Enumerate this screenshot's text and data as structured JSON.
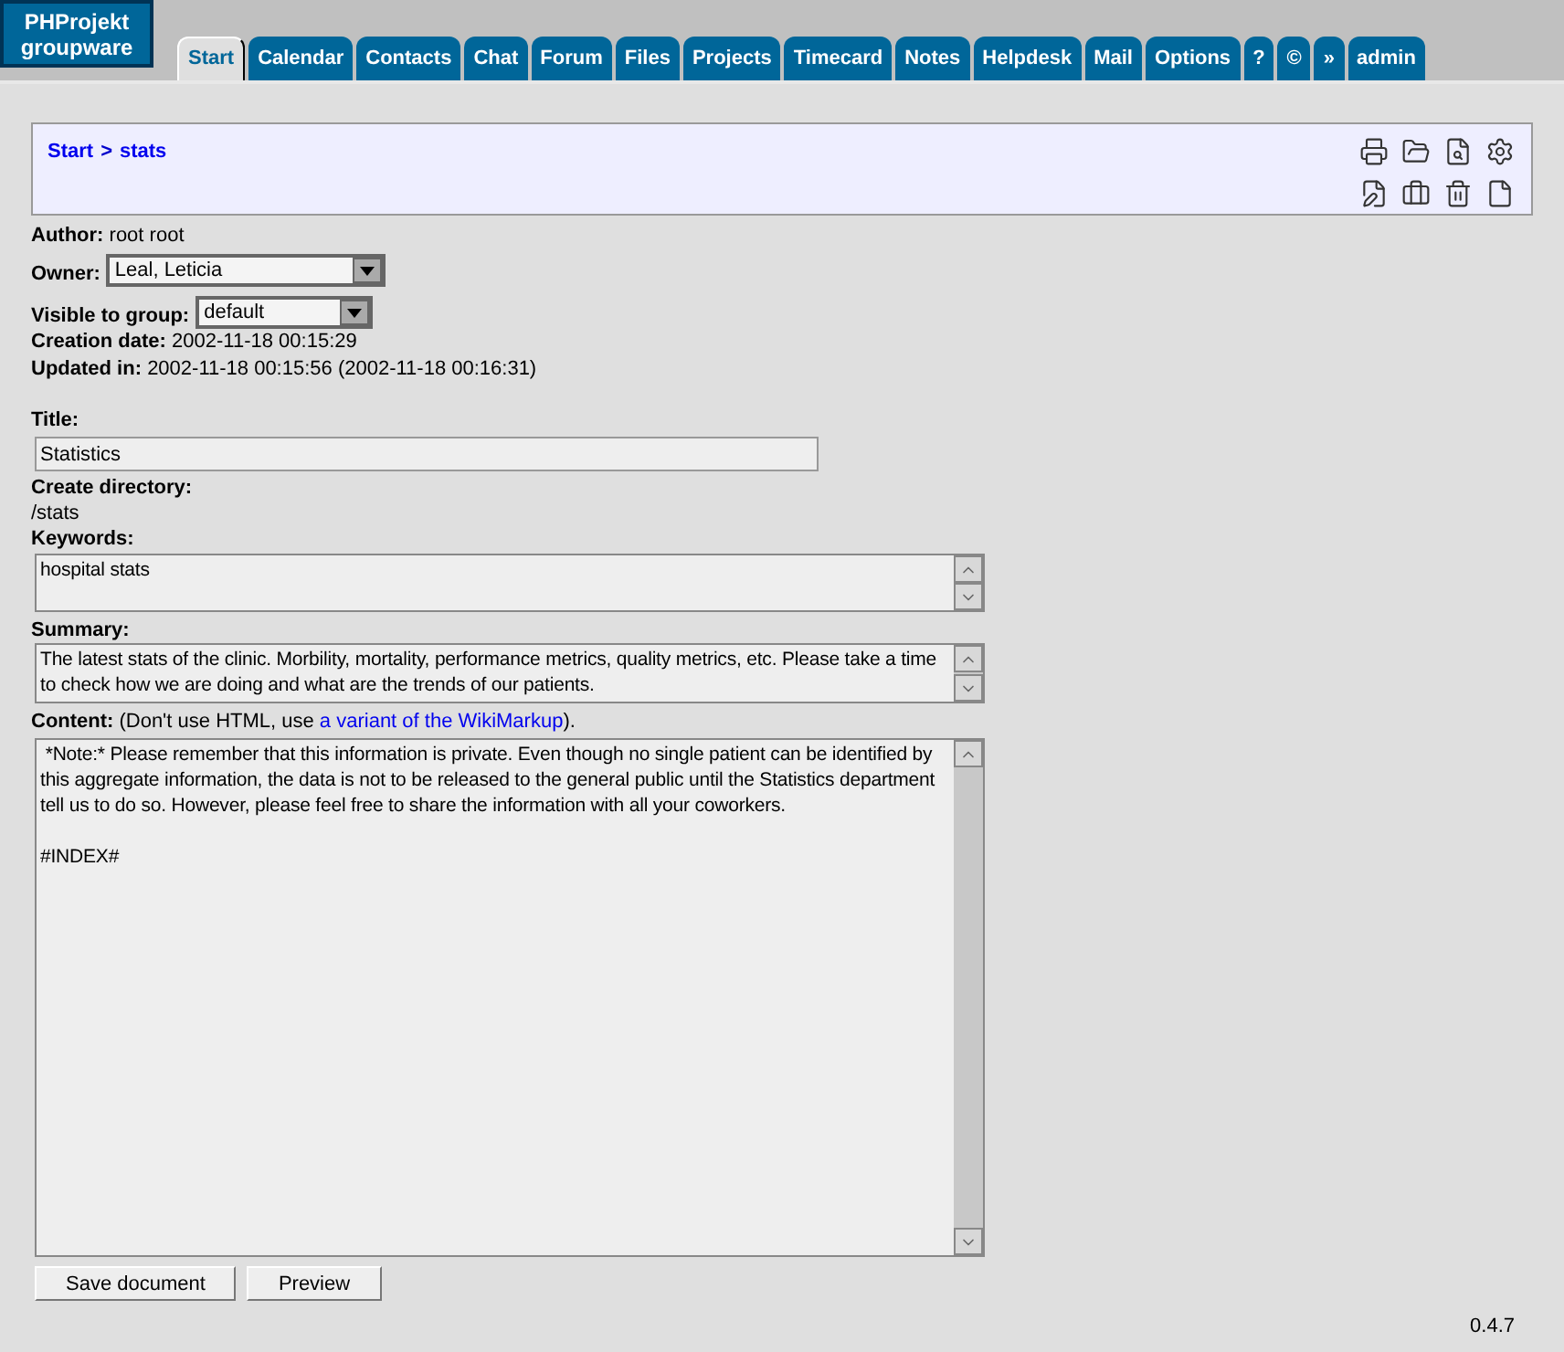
{
  "logo": {
    "line1": "PHProjekt",
    "line2": "groupware"
  },
  "tabs": [
    {
      "label": "Start",
      "selected": true
    },
    {
      "label": "Calendar",
      "selected": false
    },
    {
      "label": "Contacts",
      "selected": false
    },
    {
      "label": "Chat",
      "selected": false
    },
    {
      "label": "Forum",
      "selected": false
    },
    {
      "label": "Files",
      "selected": false
    },
    {
      "label": "Projects",
      "selected": false
    },
    {
      "label": "Timecard",
      "selected": false
    },
    {
      "label": "Notes",
      "selected": false
    },
    {
      "label": "Helpdesk",
      "selected": false
    },
    {
      "label": "Mail",
      "selected": false
    },
    {
      "label": "Options",
      "selected": false
    },
    {
      "label": "?",
      "selected": false
    },
    {
      "label": "©",
      "selected": false
    },
    {
      "label": "»",
      "selected": false
    },
    {
      "label": "admin",
      "selected": false
    }
  ],
  "breadcrumb": [
    {
      "label": "Start"
    },
    {
      "label": "stats"
    }
  ],
  "breadcrumb_separator": ">",
  "toolbar": [
    {
      "kind": "print"
    },
    {
      "kind": "folder"
    },
    {
      "kind": "preview"
    },
    {
      "kind": "settings"
    },
    {
      "kind": "edit"
    },
    {
      "kind": "tools"
    },
    {
      "kind": "trash"
    },
    {
      "kind": "new"
    }
  ],
  "meta": {
    "author_label": "Author:",
    "author": "root root",
    "owner_label": "Owner:",
    "owner": "Leal, Leticia",
    "group_label": "Visible to group:",
    "group": "default",
    "created_label": "Creation date:",
    "created": "2002-11-18 00:15:29",
    "updated_label": "Updated in:",
    "updated": "2002-11-18 00:15:56 (2002-11-18 00:16:31)"
  },
  "form": {
    "title_label": "Title:",
    "title": "Statistics",
    "directory_label": "Create directory:",
    "directory": "/stats",
    "keywords_label": "Keywords:",
    "keywords": "hospital stats",
    "summary_label": "Summary:",
    "summary": "The latest stats of the clinic. Morbility, mortality, performance metrics, quality metrics, etc. Please take a time to check how we are doing and what are the trends of our patients.",
    "content_label": "Content:",
    "content_note_before": "(Don't use HTML, use",
    "content_link": "a variant of the WikiMarkup",
    "content_note_after": ").",
    "content": " *Note:* Please remember that this information is private. Even though no single patient can be identified by this aggregate information, the data is not to be released to the general public until the Statistics department tell us to do so. However, please feel free to share the information with all your coworkers.\n\n#INDEX#"
  },
  "buttons": [
    {
      "label": "Save document"
    },
    {
      "label": "Preview"
    }
  ],
  "version": "0.4.7"
}
